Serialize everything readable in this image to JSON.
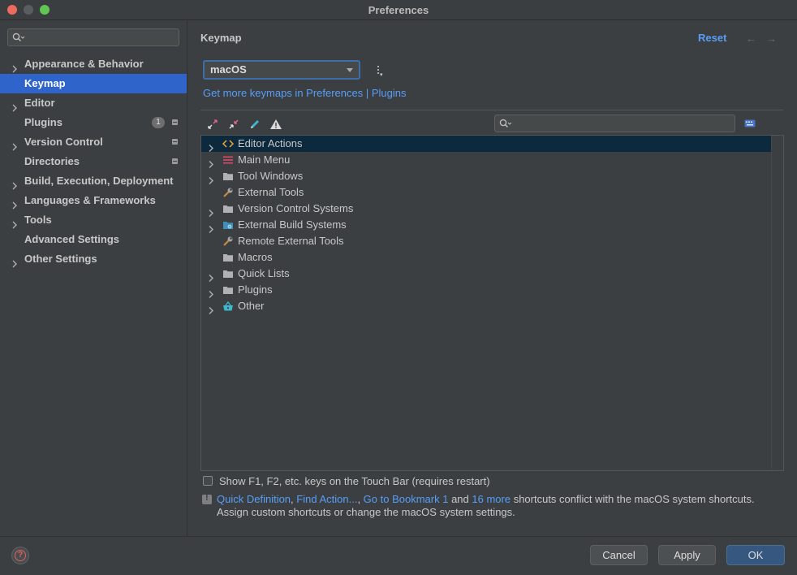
{
  "window": {
    "title": "Preferences"
  },
  "sidebar": {
    "search_placeholder": "",
    "items": [
      {
        "label": "Appearance & Behavior",
        "expandable": true
      },
      {
        "label": "Keymap",
        "expandable": false,
        "selected": true
      },
      {
        "label": "Editor",
        "expandable": true
      },
      {
        "label": "Plugins",
        "expandable": false,
        "badge": "1",
        "project_icon": true
      },
      {
        "label": "Version Control",
        "expandable": true,
        "project_icon": true
      },
      {
        "label": "Directories",
        "expandable": false,
        "project_icon": true
      },
      {
        "label": "Build, Execution, Deployment",
        "expandable": true
      },
      {
        "label": "Languages & Frameworks",
        "expandable": true
      },
      {
        "label": "Tools",
        "expandable": true
      },
      {
        "label": "Advanced Settings",
        "expandable": false
      },
      {
        "label": "Other Settings",
        "expandable": true
      }
    ]
  },
  "main": {
    "title": "Keymap",
    "reset_label": "Reset",
    "keymap_select": {
      "value": "macOS"
    },
    "get_more_link": "Get more keymaps in Preferences | Plugins",
    "toolbar_icons": [
      "expand-all-icon",
      "collapse-all-icon",
      "edit-shortcut-icon",
      "conflicts-warning-icon"
    ],
    "tree_search_placeholder": "",
    "tree": [
      {
        "label": "Editor Actions",
        "icon": "editor-actions-icon",
        "expandable": true,
        "selected": true
      },
      {
        "label": "Main Menu",
        "icon": "main-menu-icon",
        "expandable": true
      },
      {
        "label": "Tool Windows",
        "icon": "folder-icon",
        "expandable": true
      },
      {
        "label": "External Tools",
        "icon": "wrench-icon",
        "expandable": false
      },
      {
        "label": "Version Control Systems",
        "icon": "folder-icon",
        "expandable": true
      },
      {
        "label": "External Build Systems",
        "icon": "build-folder-icon",
        "expandable": true
      },
      {
        "label": "Remote External Tools",
        "icon": "wrench-icon",
        "expandable": false
      },
      {
        "label": "Macros",
        "icon": "folder-icon",
        "expandable": false
      },
      {
        "label": "Quick Lists",
        "icon": "folder-icon",
        "expandable": true
      },
      {
        "label": "Plugins",
        "icon": "folder-icon",
        "expandable": true
      },
      {
        "label": "Other",
        "icon": "basket-icon",
        "expandable": true
      }
    ],
    "touchbar_checkbox_label": "Show F1, F2, etc. keys on the Touch Bar (requires restart)",
    "touchbar_checked": false,
    "conflict": {
      "link1": "Quick Definition",
      "sep1": ", ",
      "link2": "Find Action...",
      "sep2": ", ",
      "link3": "Go to Bookmark 1",
      "sep3": " and ",
      "link4": "16 more",
      "text_after": " shortcuts conflict with the macOS system shortcuts.",
      "line2": "Assign custom shortcuts or change the macOS system settings."
    }
  },
  "buttons": {
    "cancel": "Cancel",
    "apply": "Apply",
    "ok": "OK"
  },
  "colors": {
    "accent": "#2f65ca",
    "link": "#589df6",
    "primary_button": "#365880"
  }
}
